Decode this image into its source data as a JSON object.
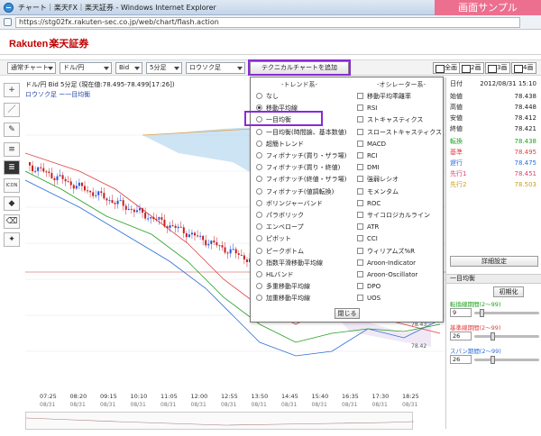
{
  "window": {
    "title": "チャート｜楽天FX｜楽天証券 - Windows Internet Explorer",
    "url": "https://stg02fx.rakuten-sec.co.jp/web/chart/flash.action",
    "sample_badge": "画面サンプル"
  },
  "brand": {
    "logo_en": "Rakuten",
    "logo_jp": "楽天証券"
  },
  "toolbar": {
    "chart_type": "通常チャート",
    "pair": "ドル/円",
    "bid": "Bid",
    "interval": "5分足",
    "style": "ロウソク足",
    "add_technical_label": "テクニカルチャートを追加",
    "splits": [
      "全画",
      "2画",
      "3画",
      "4画"
    ]
  },
  "tools": [
    "+",
    "／",
    "✎",
    "≡",
    "≣",
    "ICON",
    "◆",
    "⌫",
    "✦"
  ],
  "chart": {
    "header": "ドル/円 Bid 5分足 (現在値:78.495-78.499[17:26])",
    "sub_label": "ロウソク足 ー一目均衡",
    "times": [
      "07:25",
      "08:20",
      "09:15",
      "10:10",
      "11:05",
      "12:00",
      "12:55",
      "13:50",
      "14:45",
      "15:40",
      "16:35",
      "17:30",
      "18:25"
    ],
    "dates": [
      "08/31",
      "08/31",
      "08/31",
      "08/31",
      "08/31",
      "08/31",
      "08/31",
      "08/31",
      "08/31",
      "08/31",
      "08/31",
      "08/31",
      "08/31"
    ],
    "right_axis": [
      "78.42"
    ],
    "right_axis_ticks": [
      "78.43",
      "78.42"
    ],
    "colors": {
      "up": "#2b50d8",
      "down": "#c82020",
      "tenkan": "#e04040",
      "kijun": "#2b6fd8",
      "span1": "#e0a040",
      "cloud": "#b8d8f0"
    }
  },
  "popup": {
    "trend_header": "-トレンド系-",
    "osc_header": "-オシレーター系-",
    "trend_items": [
      {
        "label": "なし",
        "selected": false
      },
      {
        "label": "移動平均線",
        "selected": true
      },
      {
        "label": "一目均衡",
        "selected": false
      },
      {
        "label": "一目均衡(時間論、基本数値)",
        "selected": false
      },
      {
        "label": "超簡トレンド",
        "selected": false
      },
      {
        "label": "フィボナッチ(買り・ザラ場)",
        "selected": false
      },
      {
        "label": "フィボナッチ(買り・終値)",
        "selected": false
      },
      {
        "label": "フィボナッチ(終値・ザラ場)",
        "selected": false
      },
      {
        "label": "フィボナッチ(値調転換)",
        "selected": false
      },
      {
        "label": "ボリンジャーバンド",
        "selected": false
      },
      {
        "label": "パラボリック",
        "selected": false
      },
      {
        "label": "エンベロープ",
        "selected": false
      },
      {
        "label": "ピボット",
        "selected": false
      },
      {
        "label": "ピークボトム",
        "selected": false
      },
      {
        "label": "指数平滑移動平均線",
        "selected": false
      },
      {
        "label": "HLバンド",
        "selected": false
      },
      {
        "label": "多重移動平均線",
        "selected": false
      },
      {
        "label": "加重移動平均線",
        "selected": false
      }
    ],
    "osc_items": [
      "移動平均乖離率",
      "RSI",
      "ストキャスティクス",
      "スローストキャスティクス",
      "MACD",
      "RCI",
      "DMI",
      "強弱レシオ",
      "モメンタム",
      "ROC",
      "サイコロジカルライン",
      "ATR",
      "CCI",
      "ウィリアムズ%R",
      "Aroon-Indicator",
      "Aroon-Oscillator",
      "DPO",
      "UOS"
    ],
    "close_label": "閉じる"
  },
  "right_panel": {
    "date_label": "日付",
    "date_value": "2012/08/31 15:10",
    "ohlc": [
      {
        "label": "始値",
        "value": "78.438"
      },
      {
        "label": "高値",
        "value": "78.448"
      },
      {
        "label": "安値",
        "value": "78.412"
      },
      {
        "label": "終値",
        "value": "78.421"
      }
    ],
    "ichimoku": [
      {
        "label": "転換",
        "value": "78.438",
        "color": "#20a020"
      },
      {
        "label": "基準",
        "value": "78.495",
        "color": "#e04040"
      },
      {
        "label": "遅行",
        "value": "78.475",
        "color": "#2b6fd8"
      },
      {
        "label": "先行1",
        "value": "78.451",
        "color": "#e04070"
      },
      {
        "label": "先行2",
        "value": "78.503",
        "color": "#c8a020"
      }
    ],
    "detail_button": "詳細設定",
    "section_title": "一目均衡",
    "init_button": "初期化",
    "params": [
      {
        "label": "転換線期間(2〜99)",
        "value": "9",
        "color": "#20a020"
      },
      {
        "label": "基準線期間(2〜99)",
        "value": "26",
        "color": "#e04040"
      },
      {
        "label": "スパン期間(2〜99)",
        "value": "26",
        "color": "#2b6fd8"
      }
    ]
  }
}
